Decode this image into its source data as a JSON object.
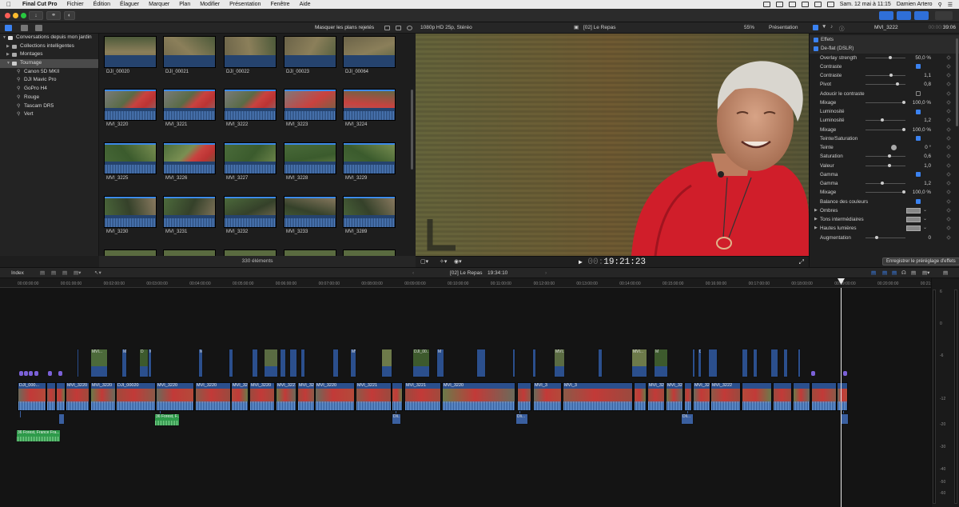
{
  "menubar": {
    "app": "Final Cut Pro",
    "items": [
      "Fichier",
      "Édition",
      "Élaguer",
      "Marquer",
      "Plan",
      "Modifier",
      "Présentation",
      "Fenêtre",
      "Aide"
    ],
    "datetime": "Sam. 12 mai à 11:15",
    "user": "Damien Artero"
  },
  "library": {
    "root": "Conversations depuis mon jardin",
    "items": [
      {
        "label": "Collections intelligentes",
        "kind": "folder"
      },
      {
        "label": "Montages",
        "kind": "folder"
      },
      {
        "label": "Tournage",
        "kind": "event",
        "selected": true
      },
      {
        "label": "Canon 5D MKII",
        "kind": "keyword"
      },
      {
        "label": "DJI Mavic Pro",
        "kind": "keyword"
      },
      {
        "label": "GoPro H4",
        "kind": "keyword"
      },
      {
        "label": "Rouge",
        "kind": "keyword"
      },
      {
        "label": "Tascam DR5",
        "kind": "keyword"
      },
      {
        "label": "Vert",
        "kind": "keyword"
      }
    ]
  },
  "browser": {
    "filter": "Masquer les plans rejetés",
    "count": "330 éléments",
    "clips": [
      [
        "DJI_00020",
        "DJI_00021",
        "DJI_00022",
        "DJI_00023",
        "DJI_00064"
      ],
      [
        "MVI_3220",
        "MVI_3221",
        "MVI_3222",
        "MVI_3223",
        "MVI_3224"
      ],
      [
        "MVI_3225",
        "MVI_3226",
        "MVI_3227",
        "MVI_3228",
        "MVI_3229"
      ],
      [
        "MVI_3230",
        "MVI_3231",
        "MVI_3232",
        "MVI_3233",
        "MVI_3289"
      ]
    ]
  },
  "viewer": {
    "format": "1080p HD 25p, Stéréo",
    "title": "[02] Le Repas",
    "zoom": "55%",
    "presentation": "Présentation",
    "timecode_dim": "00:",
    "timecode": "19:21:23"
  },
  "inspector": {
    "clip": "MVI_3222",
    "time": "39:06",
    "time_dim": "00:00:",
    "save_preset": "Enregistrer le préréglage d'effets",
    "rows": [
      {
        "label": "Effets",
        "type": "head"
      },
      {
        "label": "De-flat (DSLR)",
        "type": "head"
      },
      {
        "label": "Overlay strength",
        "type": "slider",
        "value": "50,0 %",
        "pos": 0.62
      },
      {
        "label": "Contraste",
        "type": "check",
        "on": true
      },
      {
        "label": "Contraste",
        "type": "slider",
        "value": "1,1",
        "pos": 0.66
      },
      {
        "label": "Pivot",
        "type": "slider",
        "value": "0,8",
        "pos": 0.82
      },
      {
        "label": "Adoucir le contraste",
        "type": "check",
        "on": false
      },
      {
        "label": "Mixage",
        "type": "slider",
        "value": "100,0 %",
        "pos": 1.0
      },
      {
        "label": "Luminosité",
        "type": "check",
        "on": true
      },
      {
        "label": "Luminosité",
        "type": "slider",
        "value": "1,2",
        "pos": 0.42
      },
      {
        "label": "Mixage",
        "type": "slider",
        "value": "100,0 %",
        "pos": 1.0
      },
      {
        "label": "Teinte/Saturation",
        "type": "check",
        "on": true
      },
      {
        "label": "Teinte",
        "type": "dial",
        "value": "0 °"
      },
      {
        "label": "Saturation",
        "type": "slider",
        "value": "0,6",
        "pos": 0.6
      },
      {
        "label": "Valeur",
        "type": "slider",
        "value": "1,0",
        "pos": 0.6
      },
      {
        "label": "Gamma",
        "type": "check",
        "on": true
      },
      {
        "label": "Gamma",
        "type": "slider",
        "value": "1,2",
        "pos": 0.42
      },
      {
        "label": "Mixage",
        "type": "slider",
        "value": "100,0 %",
        "pos": 1.0
      },
      {
        "label": "Balance des couleurs",
        "type": "check",
        "on": true
      },
      {
        "label": "Ombres",
        "type": "swatch"
      },
      {
        "label": "Tons intermédiaires",
        "type": "swatch"
      },
      {
        "label": "Hautes lumières",
        "type": "swatch"
      },
      {
        "label": "Augmentation",
        "type": "slider",
        "value": "0",
        "pos": 0.25
      }
    ]
  },
  "timeline": {
    "index": "Index",
    "project": "[02] Le Repas",
    "duration": "19:34:10",
    "ruler": [
      "00:00:00:00",
      "00:01:00:00",
      "00:02:00:00",
      "00:03:00:00",
      "00:04:00:00",
      "00:05:00:00",
      "00:06:00:00",
      "00:07:00:00",
      "00:08:00:00",
      "00:09:00:00",
      "00:10:00:00",
      "00:11:00:00",
      "00:12:00:00",
      "00:13:00:00",
      "00:14:00:00",
      "00:15:00:00",
      "00:16:00:00",
      "00:17:00:00",
      "00:18:00:00",
      "00:19:00:00",
      "00:20:00:00",
      "00:21:0"
    ],
    "primary_labels": [
      "DJI_000...",
      "MVI_3220",
      "MVI_3220",
      "DJI_00020",
      "MVI_3220",
      "MVI_3220",
      "MVI_3220",
      "MVI_3220",
      "MVI_3221",
      "MVI_3221",
      "MVI_3220",
      "MVI_3221",
      "MVI_3221",
      "MVI_3220",
      "MVI_3",
      "MVI_3",
      "MVI_3222",
      "MVI_3222",
      "MVI_3222",
      "MVI_3222"
    ],
    "broll_labels": [
      "MVI...",
      "M",
      "D",
      "M",
      "M",
      "MVI...",
      "DJI_00...",
      "M",
      "MVI...",
      "MVI...",
      "M",
      "D",
      "M"
    ],
    "audio_labels": [
      "36 Forest, F...",
      "Dli...",
      "Dli...",
      "Dli...",
      "36 Forest, France Fra..."
    ],
    "meter_db": [
      "6",
      "0",
      "-6",
      "-12",
      "-20",
      "-30",
      "-40",
      "-50",
      "-60"
    ]
  },
  "colors": {
    "accent": "#2f6fd8",
    "clip_blue": "#2b4f8d",
    "audio_green": "#2e9a4a",
    "marker_purple": "#7b61d8"
  }
}
